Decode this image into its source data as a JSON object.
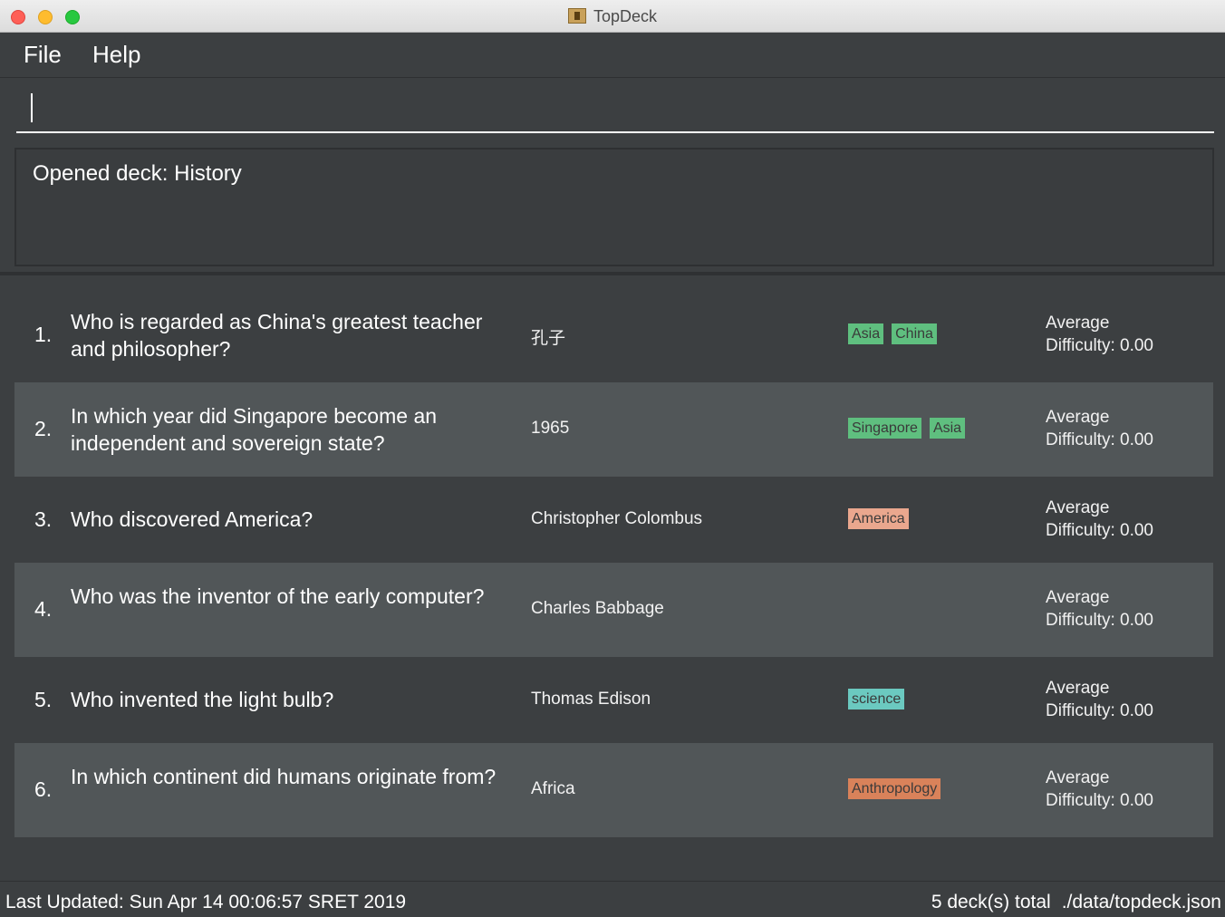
{
  "window": {
    "title": "TopDeck"
  },
  "menu": {
    "file": "File",
    "help": "Help"
  },
  "command": {
    "value": "",
    "placeholder": ""
  },
  "result": {
    "text": "Opened deck: History"
  },
  "cards": [
    {
      "index": "1.",
      "question": "Who is regarded as China's greatest teacher and philosopher?",
      "answer": "孔子",
      "tags": [
        {
          "label": "Asia",
          "color": "#5fbf7f"
        },
        {
          "label": "China",
          "color": "#5fbf7f"
        }
      ],
      "difficulty_label": "Average",
      "difficulty_value": "Difficulty: 0.00"
    },
    {
      "index": "2.",
      "question": "In which year did Singapore become an independent and sovereign state?",
      "answer": "1965",
      "tags": [
        {
          "label": "Singapore",
          "color": "#5fbf7f"
        },
        {
          "label": "Asia",
          "color": "#5fbf7f"
        }
      ],
      "difficulty_label": "Average",
      "difficulty_value": "Difficulty: 0.00"
    },
    {
      "index": "3.",
      "question": "Who discovered America?",
      "answer": "Christopher Colombus",
      "tags": [
        {
          "label": "America",
          "color": "#eaa78e"
        }
      ],
      "difficulty_label": "Average",
      "difficulty_value": "Difficulty: 0.00"
    },
    {
      "index": "4.",
      "question": "Who was the inventor of the early computer?",
      "answer": "Charles Babbage",
      "tags": [],
      "difficulty_label": "Average",
      "difficulty_value": "Difficulty: 0.00"
    },
    {
      "index": "5.",
      "question": "Who invented the light bulb?",
      "answer": "Thomas Edison",
      "tags": [
        {
          "label": "science",
          "color": "#6bc9c0"
        }
      ],
      "difficulty_label": "Average",
      "difficulty_value": "Difficulty: 0.00"
    },
    {
      "index": "6.",
      "question": "In which continent did humans originate from?",
      "answer": "Africa",
      "tags": [
        {
          "label": "Anthropology",
          "color": "#d9825a"
        }
      ],
      "difficulty_label": "Average",
      "difficulty_value": "Difficulty: 0.00"
    }
  ],
  "status": {
    "last_updated": "Last Updated: Sun Apr 14 00:06:57 SRET 2019",
    "total": "5 deck(s) total",
    "path": "./data/topdeck.json"
  }
}
